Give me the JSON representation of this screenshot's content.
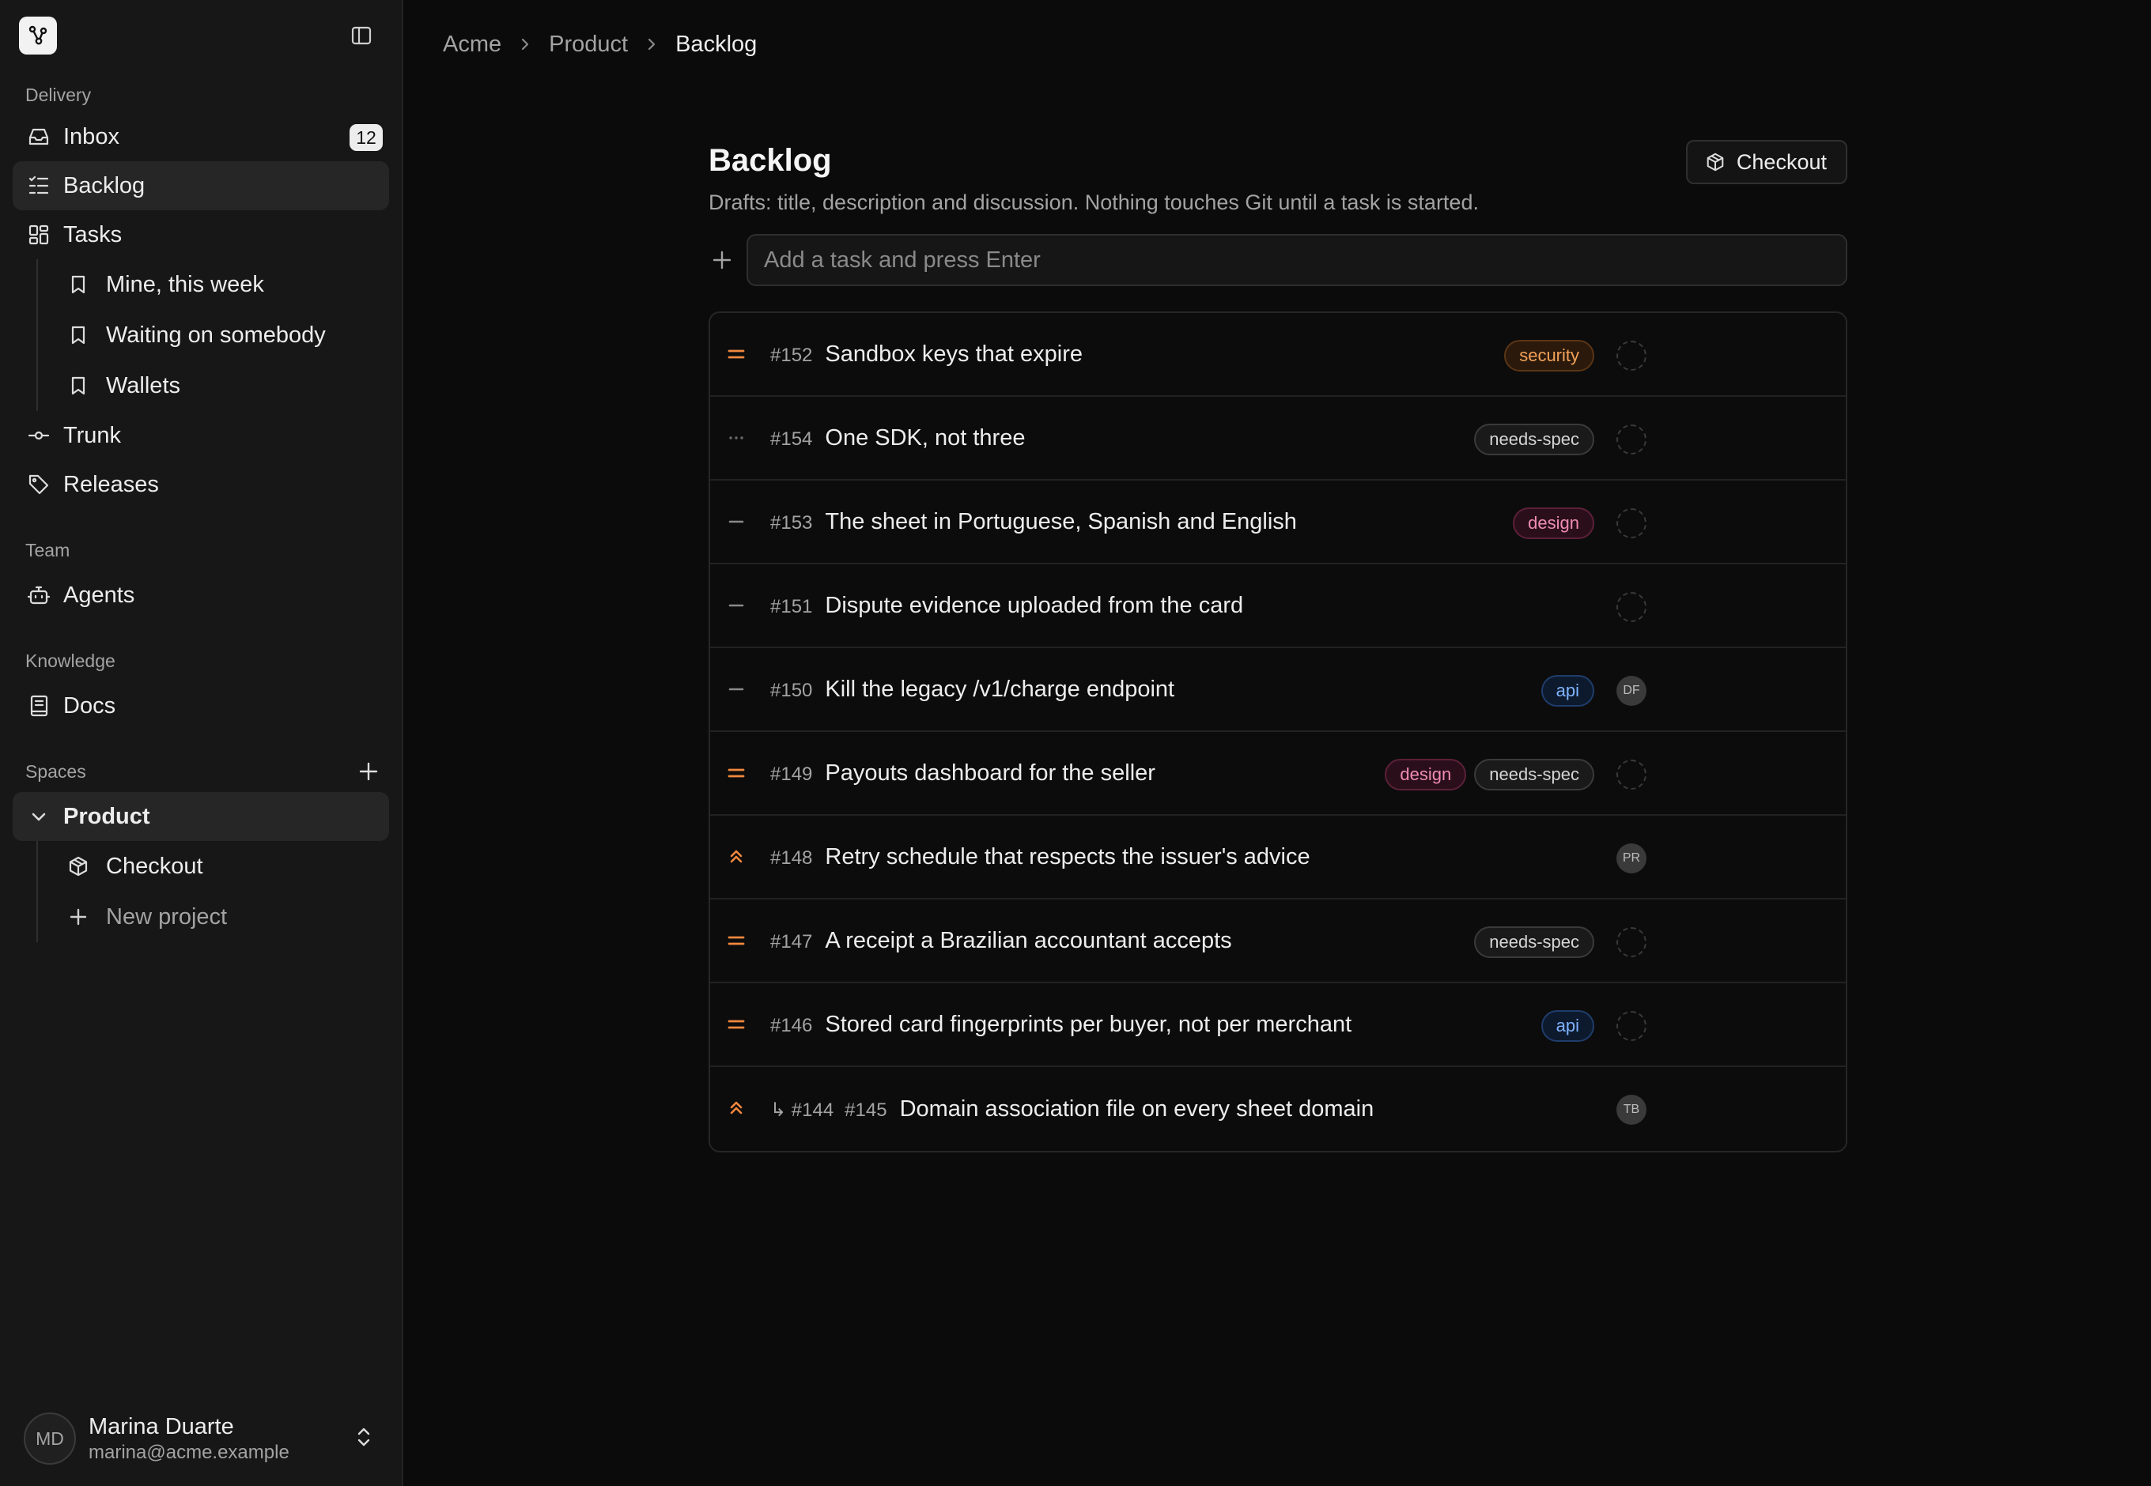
{
  "sidebar": {
    "sections": {
      "delivery": "Delivery",
      "team": "Team",
      "knowledge": "Knowledge",
      "spaces": "Spaces"
    },
    "nav": {
      "inbox": {
        "label": "Inbox",
        "badge": "12"
      },
      "backlog": {
        "label": "Backlog"
      },
      "tasks": {
        "label": "Tasks"
      },
      "views": [
        "Mine, this week",
        "Waiting on somebody",
        "Wallets"
      ],
      "trunk": {
        "label": "Trunk"
      },
      "releases": {
        "label": "Releases"
      },
      "agents": {
        "label": "Agents"
      },
      "docs": {
        "label": "Docs"
      }
    },
    "space": {
      "name": "Product",
      "projects": [
        "Checkout"
      ],
      "new_project": "New project"
    },
    "user": {
      "initials": "MD",
      "name": "Marina Duarte",
      "email": "marina@acme.example"
    }
  },
  "breadcrumb": [
    "Acme",
    "Product",
    "Backlog"
  ],
  "page": {
    "title": "Backlog",
    "subtitle": "Drafts: title, description and discussion. Nothing touches Git until a task is started.",
    "project_button": "Checkout",
    "add_placeholder": "Add a task and press Enter"
  },
  "colors": {
    "priority_orange": "#f0883e",
    "priority_gray": "#8a8a8a"
  },
  "tasks": [
    {
      "priority": "medium",
      "num": "#152",
      "title": "Sandbox keys that expire",
      "tags": [
        "security"
      ],
      "assignee": ""
    },
    {
      "priority": "none",
      "num": "#154",
      "title": "One SDK, not three",
      "tags": [
        "needs-spec"
      ],
      "assignee": ""
    },
    {
      "priority": "low",
      "num": "#153",
      "title": "The sheet in Portuguese, Spanish and English",
      "tags": [
        "design"
      ],
      "assignee": ""
    },
    {
      "priority": "low",
      "num": "#151",
      "title": "Dispute evidence uploaded from the card",
      "tags": [],
      "assignee": ""
    },
    {
      "priority": "low",
      "num": "#150",
      "title": "Kill the legacy /v1/charge endpoint",
      "tags": [
        "api"
      ],
      "assignee": "DF"
    },
    {
      "priority": "medium",
      "num": "#149",
      "title": "Payouts dashboard for the seller",
      "tags": [
        "design",
        "needs-spec"
      ],
      "assignee": ""
    },
    {
      "priority": "high",
      "num": "#148",
      "title": "Retry schedule that respects the issuer's advice",
      "tags": [],
      "assignee": "PR"
    },
    {
      "priority": "medium",
      "num": "#147",
      "title": "A receipt a Brazilian accountant accepts",
      "tags": [
        "needs-spec"
      ],
      "assignee": ""
    },
    {
      "priority": "medium",
      "num": "#146",
      "title": "Stored card fingerprints per buyer, not per merchant",
      "tags": [
        "api"
      ],
      "assignee": ""
    },
    {
      "priority": "high",
      "parent": "↳ #144",
      "num": "#145",
      "title": "Domain association file on every sheet domain",
      "tags": [],
      "assignee": "TB"
    }
  ]
}
